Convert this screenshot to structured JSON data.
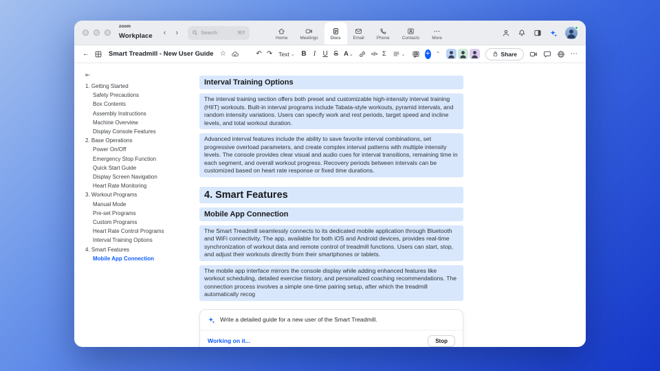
{
  "app": {
    "logo_top": "zoom",
    "logo_bottom": "Workplace",
    "search": {
      "placeholder": "Search",
      "shortcut": "⌘F"
    },
    "tabs": [
      {
        "label": "Home",
        "icon": "home",
        "active": false
      },
      {
        "label": "Meetings",
        "icon": "video",
        "active": false
      },
      {
        "label": "Docs",
        "icon": "doc",
        "active": true
      },
      {
        "label": "Email",
        "icon": "mail",
        "active": false
      },
      {
        "label": "Phone",
        "icon": "phone",
        "active": false
      },
      {
        "label": "Contacts",
        "icon": "contacts",
        "active": false
      },
      {
        "label": "More",
        "icon": "more",
        "active": false
      }
    ]
  },
  "doc_toolbar": {
    "title": "Smart Treadmill - New User Guide",
    "text_style": "Text",
    "bold": "B",
    "italic": "I",
    "underline": "U",
    "strike": "S",
    "color_label": "A",
    "code_label": "</>",
    "equation": "Σ",
    "share": "Share",
    "collaborators": [
      {
        "color": "#b9d2f8"
      },
      {
        "color": "#cfe9d9"
      },
      {
        "color": "#dccbee"
      }
    ]
  },
  "sidebar": {
    "items": [
      {
        "label": "1. Getting Started",
        "level": 1,
        "active": false
      },
      {
        "label": "Safety Precautions",
        "level": 2,
        "active": false
      },
      {
        "label": "Box Contents",
        "level": 2,
        "active": false
      },
      {
        "label": "Assembly Instructions",
        "level": 2,
        "active": false
      },
      {
        "label": "Machine Overview",
        "level": 2,
        "active": false
      },
      {
        "label": "Display Console Features",
        "level": 2,
        "active": false
      },
      {
        "label": "2. Base Operations",
        "level": 1,
        "active": false
      },
      {
        "label": "Power On/Off",
        "level": 2,
        "active": false
      },
      {
        "label": "Emergency Stop Function",
        "level": 2,
        "active": false
      },
      {
        "label": "Quick Start Guide",
        "level": 2,
        "active": false
      },
      {
        "label": "Display Screen Navigation",
        "level": 2,
        "active": false
      },
      {
        "label": "Heart Rate Monitoring",
        "level": 2,
        "active": false
      },
      {
        "label": "3. Workout Programs",
        "level": 1,
        "active": false
      },
      {
        "label": "Manual Mode",
        "level": 2,
        "active": false
      },
      {
        "label": "Pre-set Programs",
        "level": 2,
        "active": false
      },
      {
        "label": "Custom Programs",
        "level": 2,
        "active": false
      },
      {
        "label": "Heart Rate Control Programs",
        "level": 2,
        "active": false
      },
      {
        "label": "Interval Training Options",
        "level": 2,
        "active": false
      },
      {
        "label": "4. Smart Features",
        "level": 1,
        "active": false
      },
      {
        "label": "Mobile App Connection",
        "level": 2,
        "active": true
      }
    ]
  },
  "document": {
    "blocks": [
      {
        "type": "h3",
        "text": "Interval Training Options"
      },
      {
        "type": "p",
        "text": "The interval training section offers both preset and customizable high-intensity interval training (HIIT) workouts. Built-in interval programs include Tabata-style workouts, pyramid intervals, and random intensity variations. Users can specify work and rest periods, target speed and incline levels, and total workout duration."
      },
      {
        "type": "p",
        "text": "Advanced interval features include the ability to save favorite interval combinations, set progressive overload parameters, and create complex interval patterns with multiple intensity levels. The console provides clear visual and audio cues for interval transitions, remaining time in each segment, and overall workout progress. Recovery periods between intervals can be customized based on heart rate response or fixed time durations."
      },
      {
        "type": "h2",
        "text": "4. Smart Features"
      },
      {
        "type": "h3",
        "text": "Mobile App Connection"
      },
      {
        "type": "p",
        "text": "The Smart Treadmill seamlessly connects to its dedicated mobile application through Bluetooth and WiFi connectivity. The app, available for both iOS and Android devices, provides real-time synchronization of workout data and remote control of treadmill functions. Users can start, stop, and adjust their workouts directly from their smartphones or tablets."
      },
      {
        "type": "p",
        "text": "The mobile app interface mirrors the console display while adding enhanced features like workout scheduling, detailed exercise history, and personalized coaching recommendations. The connection process involves a simple one-time pairing setup, after which the treadmill automatically recog"
      }
    ]
  },
  "ai_panel": {
    "prompt": "Write a detailed guide for a new user of the Smart Treadmill.",
    "status": "Working on it...",
    "stop": "Stop"
  },
  "colors": {
    "accent": "#0b5cff",
    "highlight": "#d8e7fc"
  }
}
